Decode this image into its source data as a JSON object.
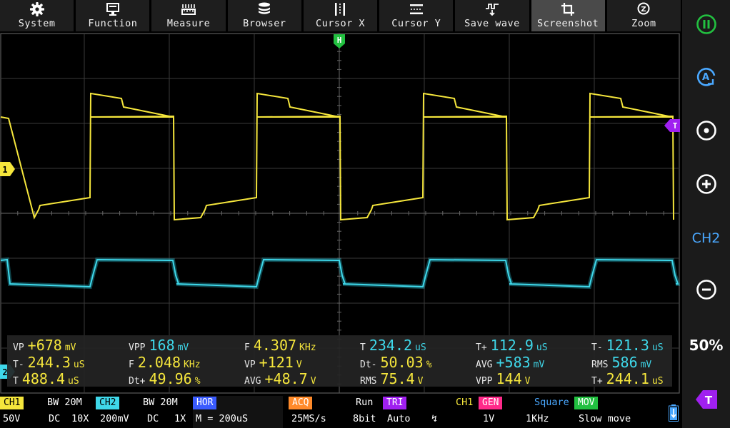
{
  "toolbar": {
    "items": [
      {
        "label": "System",
        "icon": "gear-icon"
      },
      {
        "label": "Function",
        "icon": "monitor-icon"
      },
      {
        "label": "Measure",
        "icon": "ruler-icon"
      },
      {
        "label": "Browser",
        "icon": "database-icon"
      },
      {
        "label": "Cursor X",
        "icon": "cursor-x-icon"
      },
      {
        "label": "Cursor Y",
        "icon": "cursor-y-icon"
      },
      {
        "label": "Save wave",
        "icon": "save-wave-icon"
      },
      {
        "label": "Screenshot",
        "icon": "crop-icon"
      },
      {
        "label": "Zoom",
        "icon": "zoom-icon"
      }
    ],
    "active": "Screenshot"
  },
  "markers": {
    "ch1": "1",
    "ch2": "2",
    "trigger_pos": "H",
    "trigger_level": "T"
  },
  "measurements": {
    "r1": {
      "c1": {
        "label": "VP",
        "value": "+678",
        "unit": "mV"
      },
      "c2": {
        "label": "VPP",
        "value": "168",
        "unit": "mV"
      },
      "c3": {
        "label": "F",
        "value": "4.307",
        "unit": "KHz"
      },
      "c4": {
        "label": "T",
        "value": "234.2",
        "unit": "uS"
      },
      "c5": {
        "label": "T+",
        "value": "112.9",
        "unit": "uS"
      },
      "c6": {
        "label": "T-",
        "value": "121.3",
        "unit": "uS"
      }
    },
    "r2": {
      "c1": {
        "label": "T-",
        "value": "244.3",
        "unit": "uS"
      },
      "c2": {
        "label": "F",
        "value": "2.048",
        "unit": "KHz"
      },
      "c3": {
        "label": "VP",
        "value": "+121",
        "unit": "V"
      },
      "c4": {
        "label": "Dt-",
        "value": "50.03",
        "unit": "%"
      },
      "c5": {
        "label": "AVG",
        "value": "+583",
        "unit": "mV"
      },
      "c6": {
        "label": "RMS",
        "value": "586",
        "unit": "mV"
      }
    },
    "r3": {
      "c1": {
        "label": "T",
        "value": "488.4",
        "unit": "uS"
      },
      "c2": {
        "label": "Dt+",
        "value": "49.96",
        "unit": "%"
      },
      "c3": {
        "label": "AVG",
        "value": "+48.7",
        "unit": "V"
      },
      "c4": {
        "label": "RMS",
        "value": "75.4",
        "unit": "V"
      },
      "c5": {
        "label": "VPP",
        "value": "144",
        "unit": "V"
      },
      "c6": {
        "label": "T+",
        "value": "244.1",
        "unit": "uS"
      }
    }
  },
  "status": {
    "ch1": {
      "tag": "CH1",
      "bw": "BW 20M",
      "scale": "50V",
      "coupling": "DC",
      "probe": "10X"
    },
    "ch2": {
      "tag": "CH2",
      "bw": "BW 20M",
      "scale": "200mV",
      "coupling": "DC",
      "probe": "1X"
    },
    "hor": {
      "tag": "HOR",
      "value": "M = 200uS"
    },
    "acq": {
      "tag": "ACQ",
      "mode": "Run",
      "rate": "25MS/s",
      "bits": "8bit"
    },
    "tri": {
      "tag": "TRI",
      "source": "CH1",
      "mode": "Auto",
      "edge": "↯"
    },
    "gen": {
      "tag": "GEN",
      "wave": "Square",
      "amp": "1V",
      "freq": "1KHz"
    },
    "mov": {
      "tag": "MOV",
      "value": "Slow move"
    }
  },
  "right_panel": {
    "pause": "pause-icon",
    "auto": "auto-icon",
    "center": "center-icon",
    "plus": "plus-icon",
    "channel": "CH2",
    "minus": "minus-icon",
    "percent": "50%",
    "trigger": "T"
  },
  "colors": {
    "ch1": "#f5e63c",
    "ch2": "#3fd8ea",
    "trigger": "#a020f0",
    "gen": "#ff2a8a",
    "acq": "#ff8a2a",
    "hor": "#3a5bff",
    "mov": "#22c040",
    "pause": "#22c040",
    "accent": "#4aa8ff"
  }
}
